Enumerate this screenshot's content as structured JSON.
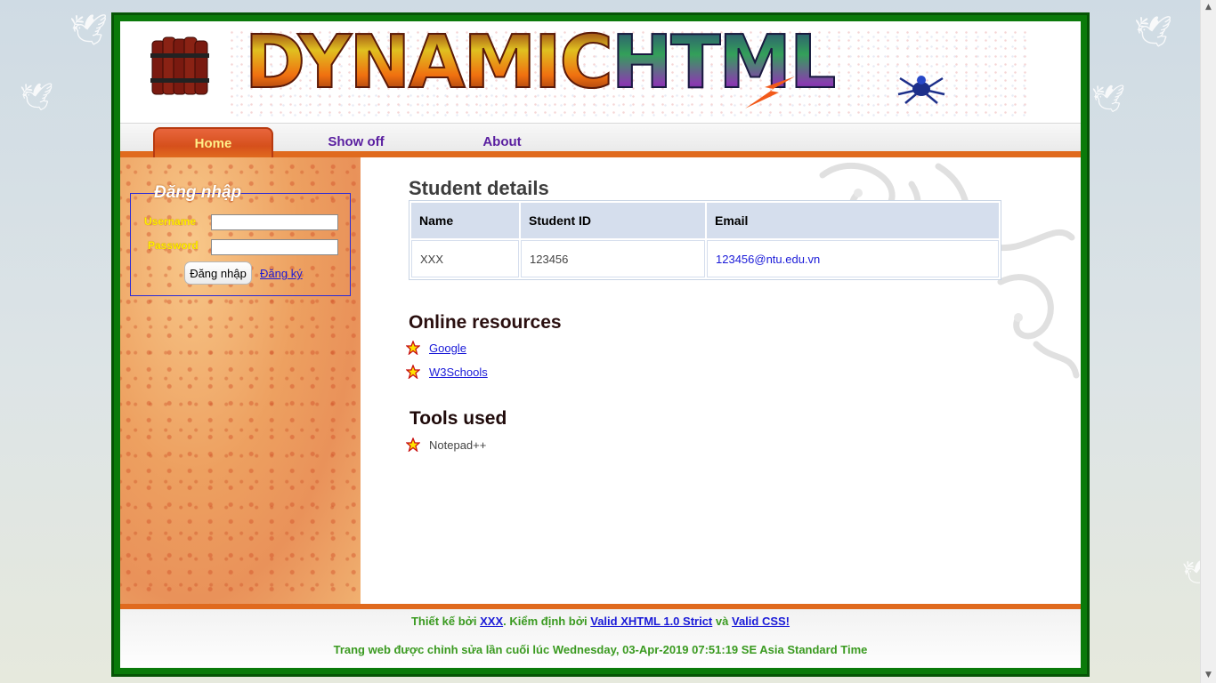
{
  "banner": {
    "title_part1": "DYNAMIC",
    "title_part2": "HTML"
  },
  "nav": {
    "items": [
      {
        "label": "Home",
        "active": true
      },
      {
        "label": "Show off",
        "active": false
      },
      {
        "label": "About",
        "active": false
      }
    ]
  },
  "login": {
    "legend": "Đăng nhập",
    "username_label": "Username",
    "password_label": "Password",
    "username_value": "",
    "password_value": "",
    "submit_label": "Đăng nhập",
    "register_label": "Đăng ký"
  },
  "student": {
    "heading": "Student details",
    "columns": [
      "Name",
      "Student ID",
      "Email"
    ],
    "rows": [
      {
        "name": "XXX",
        "id": "123456",
        "email": "123456@ntu.edu.vn"
      }
    ]
  },
  "resources": {
    "heading": "Online resources",
    "links": [
      "Google",
      "W3Schools"
    ]
  },
  "tools": {
    "heading": "Tools used",
    "items": [
      "Notepad++"
    ]
  },
  "footer": {
    "designed_by_prefix": "Thiết kế bởi",
    "designer": "XXX",
    "validated_by": ". Kiểm định bởi",
    "valid_xhtml": "Valid XHTML 1.0 Strict",
    "and": "và",
    "valid_css": "Valid CSS!",
    "last_modified": "Trang web được chỉnh sửa lần cuối lúc Wednesday, 03-Apr-2019 07:51:19 SE Asia Standard Time"
  },
  "colors": {
    "frame_green": "#0a7a0a",
    "accent_orange": "#e06a1e",
    "link_blue": "#1a1ad8",
    "footer_green": "#3a9a20",
    "label_yellow": "#ffef00"
  }
}
